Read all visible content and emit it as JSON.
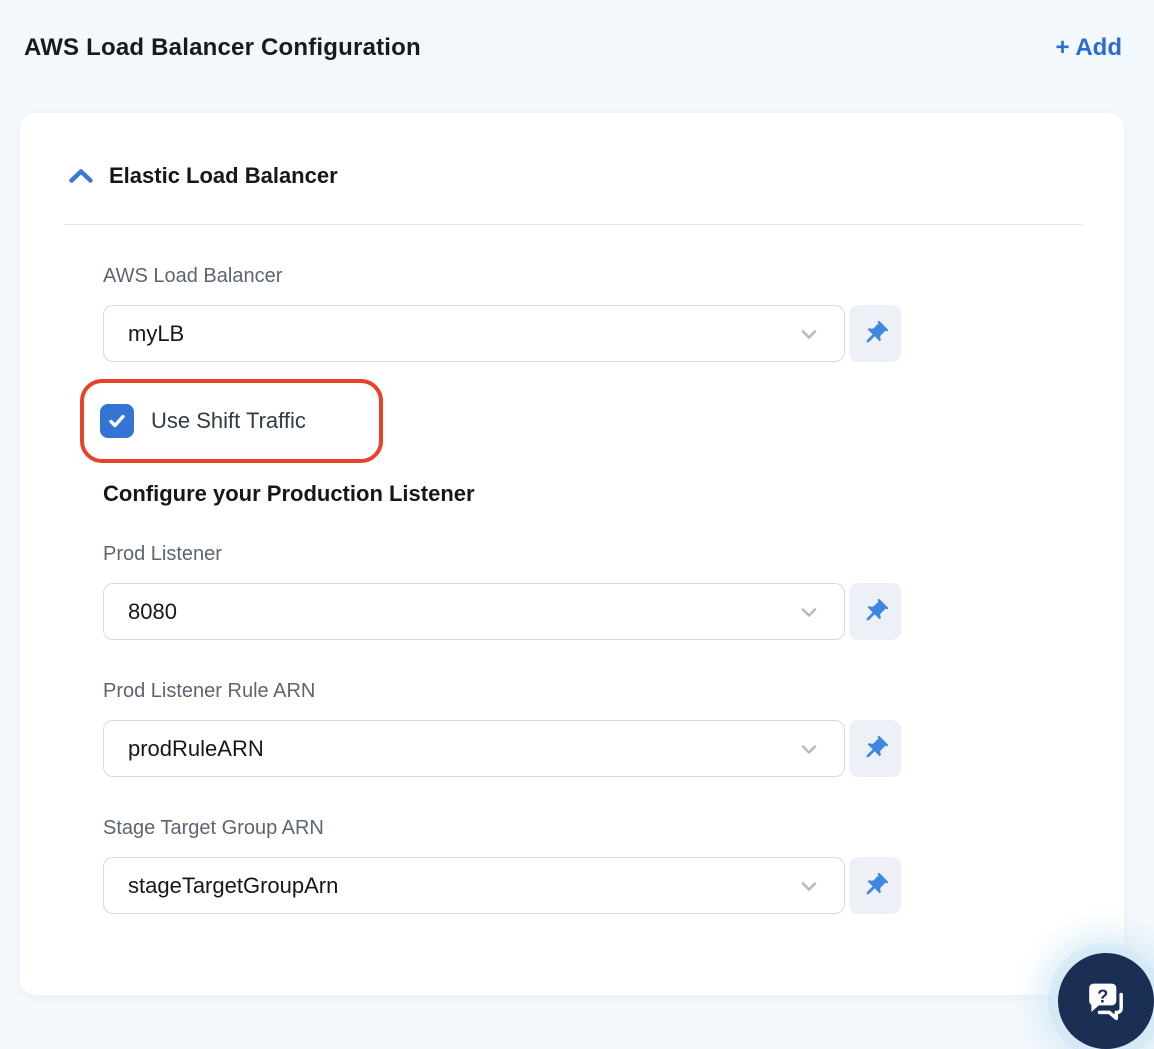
{
  "page": {
    "title": "AWS Load Balancer Configuration",
    "add_button_label": "+ Add"
  },
  "panel": {
    "section_title": "Elastic Load Balancer",
    "collapse_state": "expanded",
    "checkbox": {
      "label": "Use Shift Traffic",
      "checked": true,
      "highlighted": true
    },
    "subheading": "Configure your Production Listener",
    "fields": [
      {
        "label": "AWS Load Balancer",
        "value": "myLB"
      },
      {
        "label": "Prod Listener",
        "value": "8080"
      },
      {
        "label": "Prod Listener Rule ARN",
        "value": "prodRuleARN"
      },
      {
        "label": "Stage Target Group ARN",
        "value": "stageTargetGroupArn"
      }
    ]
  },
  "icons": {
    "section_collapse": "chevron-up-icon",
    "select": "chevron-down-icon",
    "pin": "pushpin-icon",
    "checkbox": "checkmark-icon",
    "help": "chat-help-icon"
  },
  "colors": {
    "accent_blue": "#2a6cd4",
    "checkbox_blue": "#3474d4",
    "pin_blue": "#3e86de",
    "annotation_red": "#e7432b",
    "chat_navy": "#1b2e54",
    "page_background": "#f3f8fc"
  }
}
